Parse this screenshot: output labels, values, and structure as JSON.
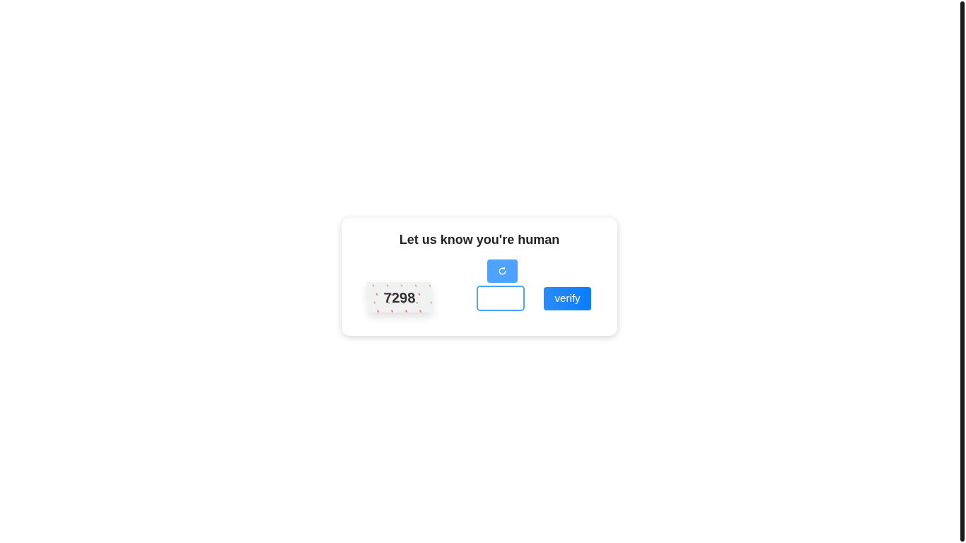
{
  "dialog": {
    "title": "Let us know you're human"
  },
  "captcha": {
    "code": "7298"
  },
  "buttons": {
    "verify": "verify"
  }
}
